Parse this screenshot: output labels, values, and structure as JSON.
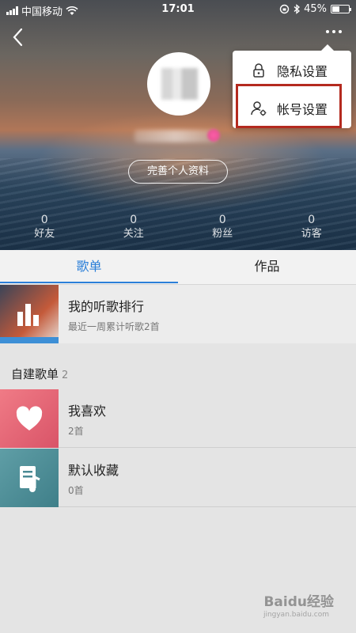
{
  "status_bar": {
    "carrier": "中国移动",
    "time": "17:01",
    "battery": "45%",
    "battery_level": 0.45
  },
  "profile": {
    "complete_profile_button": "完善个人资料",
    "stats": [
      {
        "value": "0",
        "label": "好友"
      },
      {
        "value": "0",
        "label": "关注"
      },
      {
        "value": "0",
        "label": "粉丝"
      },
      {
        "value": "0",
        "label": "访客"
      }
    ]
  },
  "dropdown_menu": {
    "items": [
      {
        "label": "隐私设置",
        "icon": "lock-icon"
      },
      {
        "label": "帐号设置",
        "icon": "user-settings-icon"
      }
    ],
    "highlight_color": "#b42a1f"
  },
  "tabs": [
    {
      "label": "歌单",
      "active": true
    },
    {
      "label": "作品",
      "active": false
    }
  ],
  "ranking": {
    "title": "我的听歌排行",
    "subtitle": "最近一周累计听歌2首"
  },
  "playlists_section": {
    "title": "自建歌单",
    "count": "2",
    "items": [
      {
        "title": "我喜欢",
        "subtitle": "2首",
        "icon": "heart-icon"
      },
      {
        "title": "默认收藏",
        "subtitle": "0首",
        "icon": "music-note-icon"
      }
    ]
  },
  "watermark": {
    "text": "Baidu经验",
    "url": "jingyan.baidu.com"
  },
  "accent_color": "#2b7fd8"
}
